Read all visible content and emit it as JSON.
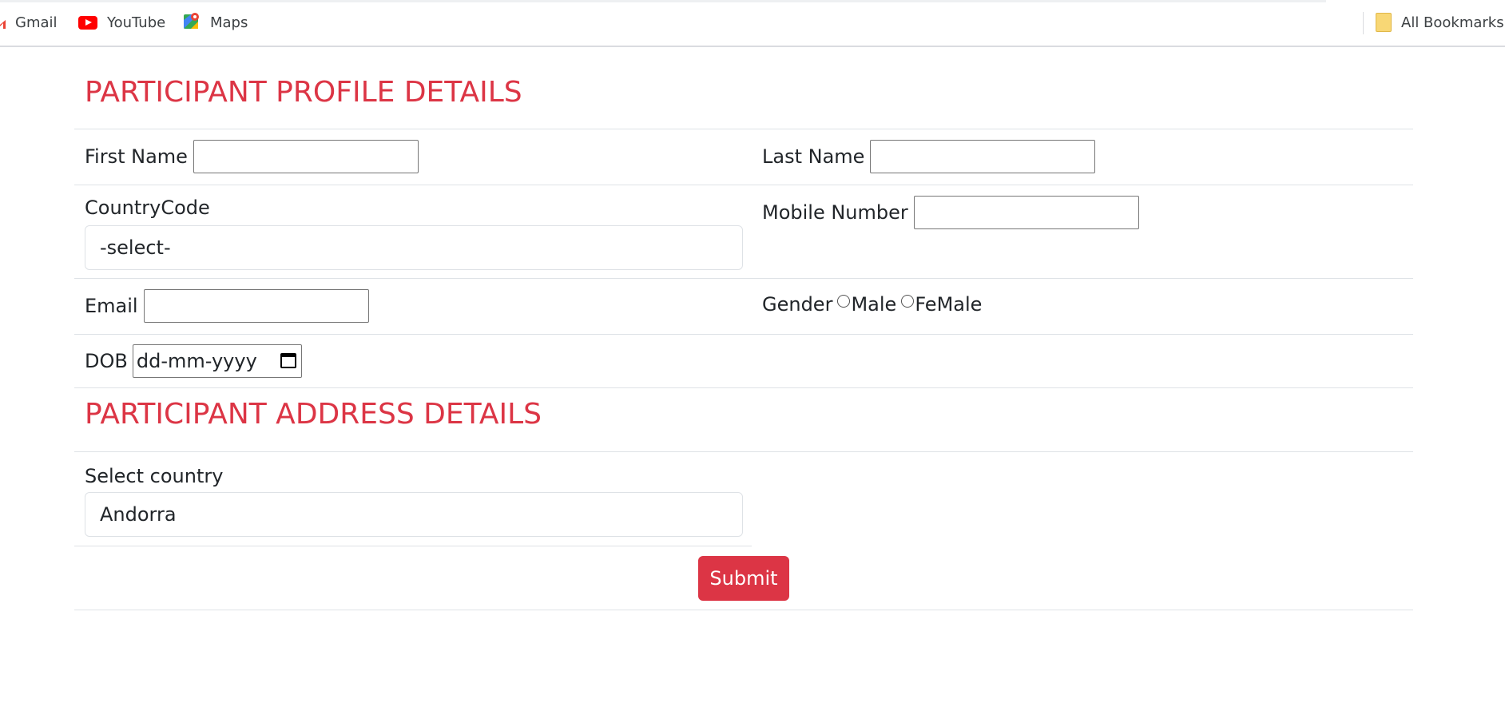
{
  "bookmarks": {
    "items": [
      {
        "label": "Gmail",
        "icon": "gmail-icon"
      },
      {
        "label": "YouTube",
        "icon": "youtube-icon"
      },
      {
        "label": "Maps",
        "icon": "maps-icon"
      }
    ],
    "all_bookmarks": {
      "label": "All Bookmarks",
      "icon": "folder-icon"
    }
  },
  "colors": {
    "accent": "#dc3545",
    "border": "#dee2e6"
  },
  "profile": {
    "title": "PARTICIPANT PROFILE DETAILS",
    "first_name_label": "First Name",
    "first_name_value": "",
    "last_name_label": "Last Name",
    "last_name_value": "",
    "country_code_label": "CountryCode",
    "country_code_selected": "-select-",
    "mobile_label": "Mobile Number",
    "mobile_value": "",
    "email_label": "Email",
    "email_value": "",
    "gender_label": "Gender",
    "gender_options": [
      "Male",
      "FeMale"
    ],
    "dob_label": "DOB",
    "dob_placeholder": "dd-mm-yyyy"
  },
  "address": {
    "title": "PARTICIPANT ADDRESS DETAILS",
    "country_label": "Select country",
    "country_selected": "Andorra"
  },
  "submit_label": "Submit"
}
